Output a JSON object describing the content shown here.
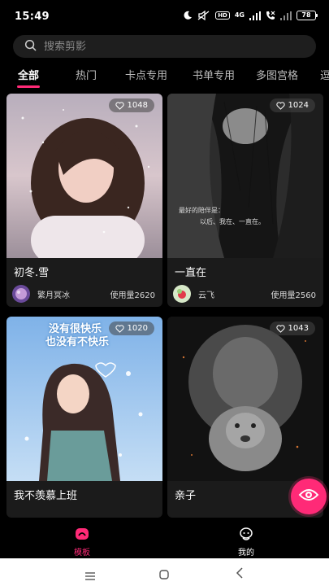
{
  "status_bar": {
    "time": "15:49",
    "battery": "78",
    "network": "4G",
    "hd_label": "HD"
  },
  "search": {
    "placeholder": "搜索剪影"
  },
  "tabs": [
    {
      "label": "全部",
      "active": true
    },
    {
      "label": "热门"
    },
    {
      "label": "卡点专用"
    },
    {
      "label": "书单专用"
    },
    {
      "label": "多图宫格"
    },
    {
      "label": "逗"
    }
  ],
  "cards": [
    {
      "title": "初冬.雪",
      "likes": "1048",
      "author": "繁月冥冰",
      "usage": "使用量2620"
    },
    {
      "title": "一直在",
      "likes": "1024",
      "author": "云飞",
      "usage": "使用量2560",
      "overlay_text": [
        "最好的陪伴是：",
        "以后、我在、一直在。"
      ]
    },
    {
      "title": "我不羡慕上班",
      "likes": "1020",
      "overlay_text": [
        "没有很快乐",
        "也没有不快乐"
      ]
    },
    {
      "title": "亲子",
      "likes": "1043"
    }
  ],
  "bottom_nav": [
    {
      "label": "模板",
      "active": true
    },
    {
      "label": "我的"
    }
  ],
  "colors": {
    "accent": "#ff2a77",
    "card_bg": "#1b1b1b",
    "search_bg": "#1e1e1e"
  }
}
